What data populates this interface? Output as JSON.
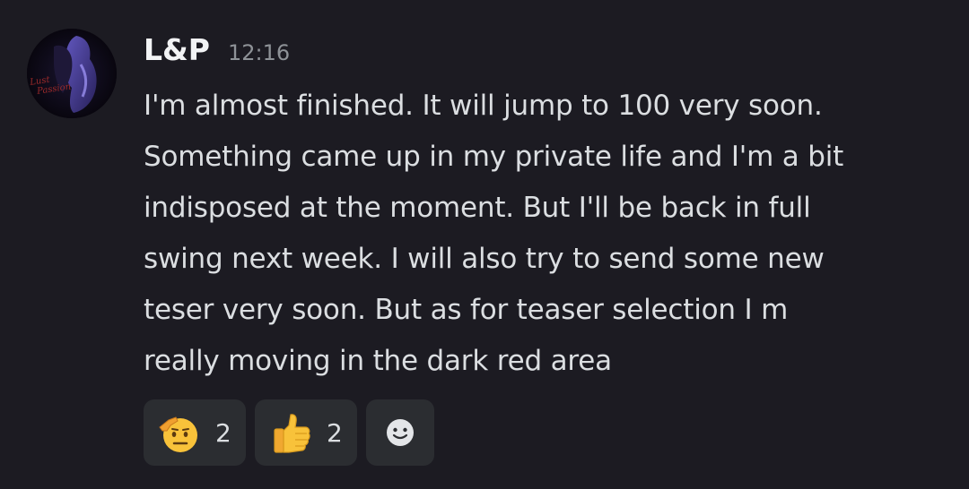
{
  "message": {
    "author": "L&P",
    "timestamp": "12:16",
    "avatar_text": "Lust & Passion",
    "lines": [
      "I'm almost finished. It will jump to 100 very soon.",
      "Something came up in my private life and I'm a bit",
      "indisposed at the moment. But I'll be back in full",
      "swing next week. I will also try to send some new",
      "teser very soon. But as for teaser selection I m",
      "really moving in the dark red area"
    ]
  },
  "reactions": [
    {
      "icon": "saluting-face-icon",
      "count": "2"
    },
    {
      "icon": "thumbs-up-icon",
      "count": "2"
    },
    {
      "icon": "add-reaction-icon"
    }
  ],
  "colors": {
    "background": "#1c1b22",
    "text": "#dbdee1",
    "muted": "#8e9297",
    "pill": "#2b2d31"
  }
}
